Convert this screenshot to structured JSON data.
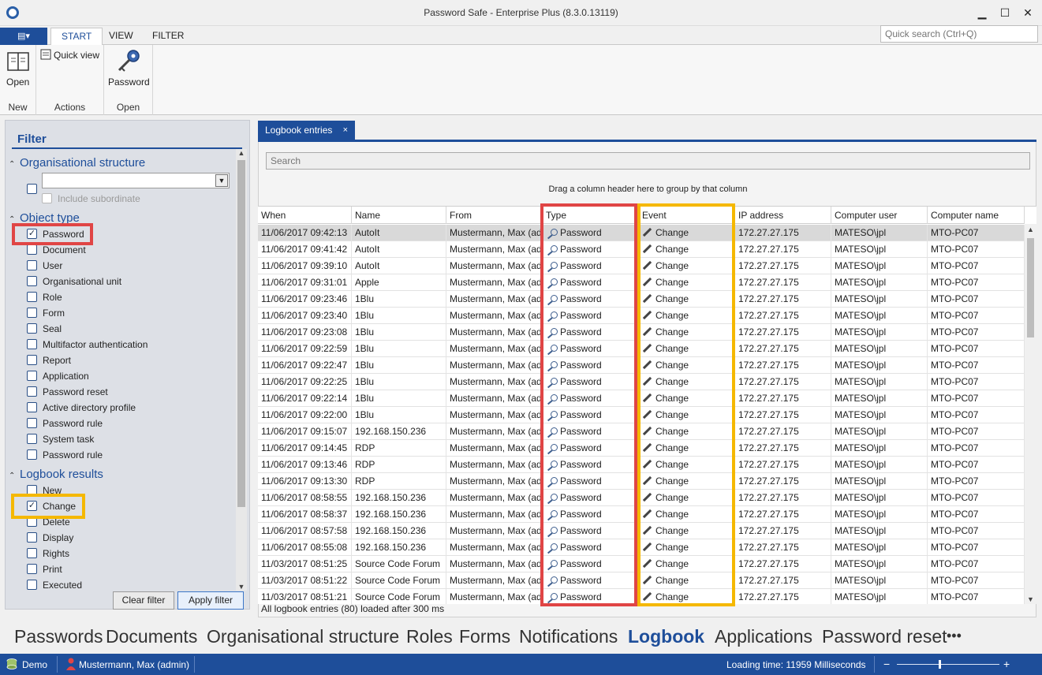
{
  "window": {
    "title": "Password Safe - Enterprise Plus (8.3.0.13119)",
    "minimize_glyph": "▁",
    "maximize_glyph": "☐",
    "close_glyph": "✕"
  },
  "ribbon": {
    "app_menu_glyph": "▤▾",
    "tabs": [
      "START",
      "VIEW",
      "FILTER"
    ],
    "quick_search_placeholder": "Quick search (Ctrl+Q)",
    "groups": [
      {
        "label": "New",
        "buttons": [
          "Open"
        ]
      },
      {
        "label": "Actions",
        "buttons": [
          "Quick view"
        ]
      },
      {
        "label": "Open",
        "buttons": [
          "Password"
        ]
      }
    ]
  },
  "filter": {
    "title": "Filter",
    "sections": {
      "org": {
        "label": "Organisational structure",
        "include_subordinate": "Include subordinate"
      },
      "object_type": {
        "label": "Object type",
        "items": [
          {
            "label": "Password",
            "checked": true
          },
          {
            "label": "Document",
            "checked": false
          },
          {
            "label": "User",
            "checked": false
          },
          {
            "label": "Organisational unit",
            "checked": false
          },
          {
            "label": "Role",
            "checked": false
          },
          {
            "label": "Form",
            "checked": false
          },
          {
            "label": "Seal",
            "checked": false
          },
          {
            "label": "Multifactor authentication",
            "checked": false
          },
          {
            "label": "Report",
            "checked": false
          },
          {
            "label": "Application",
            "checked": false
          },
          {
            "label": "Password reset",
            "checked": false
          },
          {
            "label": "Active directory profile",
            "checked": false
          },
          {
            "label": "Password rule",
            "checked": false
          },
          {
            "label": "System task",
            "checked": false
          },
          {
            "label": "Password rule",
            "checked": false
          }
        ]
      },
      "logbook_results": {
        "label": "Logbook results",
        "items": [
          {
            "label": "New",
            "checked": false
          },
          {
            "label": "Change",
            "checked": true
          },
          {
            "label": "Delete",
            "checked": false
          },
          {
            "label": "Display",
            "checked": false
          },
          {
            "label": "Rights",
            "checked": false
          },
          {
            "label": "Print",
            "checked": false
          },
          {
            "label": "Executed",
            "checked": false
          }
        ]
      }
    },
    "clear_button": "Clear filter",
    "apply_button": "Apply filter",
    "check_glyph": "✓",
    "expand_glyph": "⌃",
    "scroll_up_glyph": "▲",
    "scroll_down_glyph": "▼",
    "dropdown_glyph": "▼"
  },
  "main": {
    "tab_label": "Logbook entries",
    "tab_close": "×",
    "search_placeholder": "Search",
    "group_hint": "Drag a column header here to group by that column",
    "columns": [
      "When",
      "Name",
      "From",
      "Type",
      "Event",
      "IP address",
      "Computer user",
      "Computer name"
    ],
    "rows": [
      [
        "11/06/2017 09:42:13",
        "AutoIt",
        "Mustermann, Max (admin)",
        "Password",
        "Change",
        "172.27.27.175",
        "MATESO\\jpl",
        "MTO-PC07"
      ],
      [
        "11/06/2017 09:41:42",
        "AutoIt",
        "Mustermann, Max (admin)",
        "Password",
        "Change",
        "172.27.27.175",
        "MATESO\\jpl",
        "MTO-PC07"
      ],
      [
        "11/06/2017 09:39:10",
        "AutoIt",
        "Mustermann, Max (admin)",
        "Password",
        "Change",
        "172.27.27.175",
        "MATESO\\jpl",
        "MTO-PC07"
      ],
      [
        "11/06/2017 09:31:01",
        "Apple",
        "Mustermann, Max (admin)",
        "Password",
        "Change",
        "172.27.27.175",
        "MATESO\\jpl",
        "MTO-PC07"
      ],
      [
        "11/06/2017 09:23:46",
        "1Blu",
        "Mustermann, Max (admin)",
        "Password",
        "Change",
        "172.27.27.175",
        "MATESO\\jpl",
        "MTO-PC07"
      ],
      [
        "11/06/2017 09:23:40",
        "1Blu",
        "Mustermann, Max (admin)",
        "Password",
        "Change",
        "172.27.27.175",
        "MATESO\\jpl",
        "MTO-PC07"
      ],
      [
        "11/06/2017 09:23:08",
        "1Blu",
        "Mustermann, Max (admin)",
        "Password",
        "Change",
        "172.27.27.175",
        "MATESO\\jpl",
        "MTO-PC07"
      ],
      [
        "11/06/2017 09:22:59",
        "1Blu",
        "Mustermann, Max (admin)",
        "Password",
        "Change",
        "172.27.27.175",
        "MATESO\\jpl",
        "MTO-PC07"
      ],
      [
        "11/06/2017 09:22:47",
        "1Blu",
        "Mustermann, Max (admin)",
        "Password",
        "Change",
        "172.27.27.175",
        "MATESO\\jpl",
        "MTO-PC07"
      ],
      [
        "11/06/2017 09:22:25",
        "1Blu",
        "Mustermann, Max (admin)",
        "Password",
        "Change",
        "172.27.27.175",
        "MATESO\\jpl",
        "MTO-PC07"
      ],
      [
        "11/06/2017 09:22:14",
        "1Blu",
        "Mustermann, Max (admin)",
        "Password",
        "Change",
        "172.27.27.175",
        "MATESO\\jpl",
        "MTO-PC07"
      ],
      [
        "11/06/2017 09:22:00",
        "1Blu",
        "Mustermann, Max (admin)",
        "Password",
        "Change",
        "172.27.27.175",
        "MATESO\\jpl",
        "MTO-PC07"
      ],
      [
        "11/06/2017 09:15:07",
        "192.168.150.236",
        "Mustermann, Max (admin)",
        "Password",
        "Change",
        "172.27.27.175",
        "MATESO\\jpl",
        "MTO-PC07"
      ],
      [
        "11/06/2017 09:14:45",
        "RDP",
        "Mustermann, Max (admin)",
        "Password",
        "Change",
        "172.27.27.175",
        "MATESO\\jpl",
        "MTO-PC07"
      ],
      [
        "11/06/2017 09:13:46",
        "RDP",
        "Mustermann, Max (admin)",
        "Password",
        "Change",
        "172.27.27.175",
        "MATESO\\jpl",
        "MTO-PC07"
      ],
      [
        "11/06/2017 09:13:30",
        "RDP",
        "Mustermann, Max (admin)",
        "Password",
        "Change",
        "172.27.27.175",
        "MATESO\\jpl",
        "MTO-PC07"
      ],
      [
        "11/06/2017 08:58:55",
        "192.168.150.236",
        "Mustermann, Max (admin)",
        "Password",
        "Change",
        "172.27.27.175",
        "MATESO\\jpl",
        "MTO-PC07"
      ],
      [
        "11/06/2017 08:58:37",
        "192.168.150.236",
        "Mustermann, Max (admin)",
        "Password",
        "Change",
        "172.27.27.175",
        "MATESO\\jpl",
        "MTO-PC07"
      ],
      [
        "11/06/2017 08:57:58",
        "192.168.150.236",
        "Mustermann, Max (admin)",
        "Password",
        "Change",
        "172.27.27.175",
        "MATESO\\jpl",
        "MTO-PC07"
      ],
      [
        "11/06/2017 08:55:08",
        "192.168.150.236",
        "Mustermann, Max (admin)",
        "Password",
        "Change",
        "172.27.27.175",
        "MATESO\\jpl",
        "MTO-PC07"
      ],
      [
        "11/03/2017 08:51:25",
        "Source Code Forum",
        "Mustermann, Max (admin)",
        "Password",
        "Change",
        "172.27.27.175",
        "MATESO\\jpl",
        "MTO-PC07"
      ],
      [
        "11/03/2017 08:51:22",
        "Source Code Forum",
        "Mustermann, Max (admin)",
        "Password",
        "Change",
        "172.27.27.175",
        "MATESO\\jpl",
        "MTO-PC07"
      ],
      [
        "11/03/2017 08:51:21",
        "Source Code Forum",
        "Mustermann, Max (admin)",
        "Password",
        "Change",
        "172.27.27.175",
        "MATESO\\jpl",
        "MTO-PC07"
      ]
    ],
    "footer": "All logbook entries (80) loaded after 300 ms"
  },
  "bottom_nav": {
    "items": [
      "Passwords",
      "Documents",
      "Organisational structure",
      "Roles",
      "Forms",
      "Notifications",
      "Logbook",
      "Applications",
      "Password reset"
    ],
    "active": "Logbook",
    "more_glyph": "•••"
  },
  "status": {
    "db": "Demo",
    "user": "Mustermann, Max (admin)",
    "loading_time": "Loading time: 11959 Milliseconds",
    "zoom_minus": "−",
    "zoom_plus": "+"
  },
  "colors": {
    "accent": "#1e4e9a",
    "highlight_red": "#e04545",
    "highlight_yellow": "#f5b800"
  }
}
